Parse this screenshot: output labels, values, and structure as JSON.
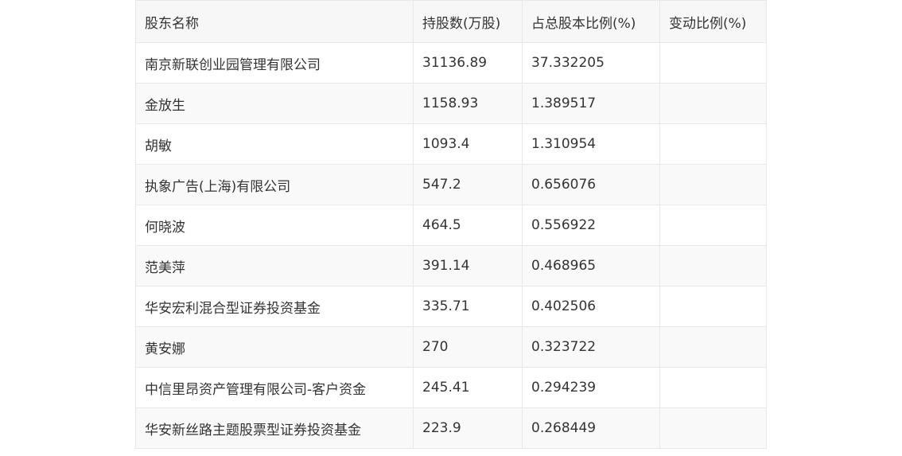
{
  "table": {
    "headers": [
      "股东名称",
      "持股数(万股)",
      "占总股本比例(%)",
      "变动比例(%)"
    ],
    "rows": [
      [
        "南京新联创业园管理有限公司",
        "31136.89",
        "37.332205",
        ""
      ],
      [
        "金放生",
        "1158.93",
        "1.389517",
        ""
      ],
      [
        "胡敏",
        "1093.4",
        "1.310954",
        ""
      ],
      [
        "执象广告(上海)有限公司",
        "547.2",
        "0.656076",
        ""
      ],
      [
        "何晓波",
        "464.5",
        "0.556922",
        ""
      ],
      [
        "范美萍",
        "391.14",
        "0.468965",
        ""
      ],
      [
        "华安宏利混合型证券投资基金",
        "335.71",
        "0.402506",
        ""
      ],
      [
        "黄安娜",
        "270",
        "0.323722",
        ""
      ],
      [
        "中信里昂资产管理有限公司-客户资金",
        "245.41",
        "0.294239",
        ""
      ],
      [
        "华安新丝路主题股票型证券投资基金",
        "223.9",
        "0.268449",
        ""
      ]
    ]
  }
}
